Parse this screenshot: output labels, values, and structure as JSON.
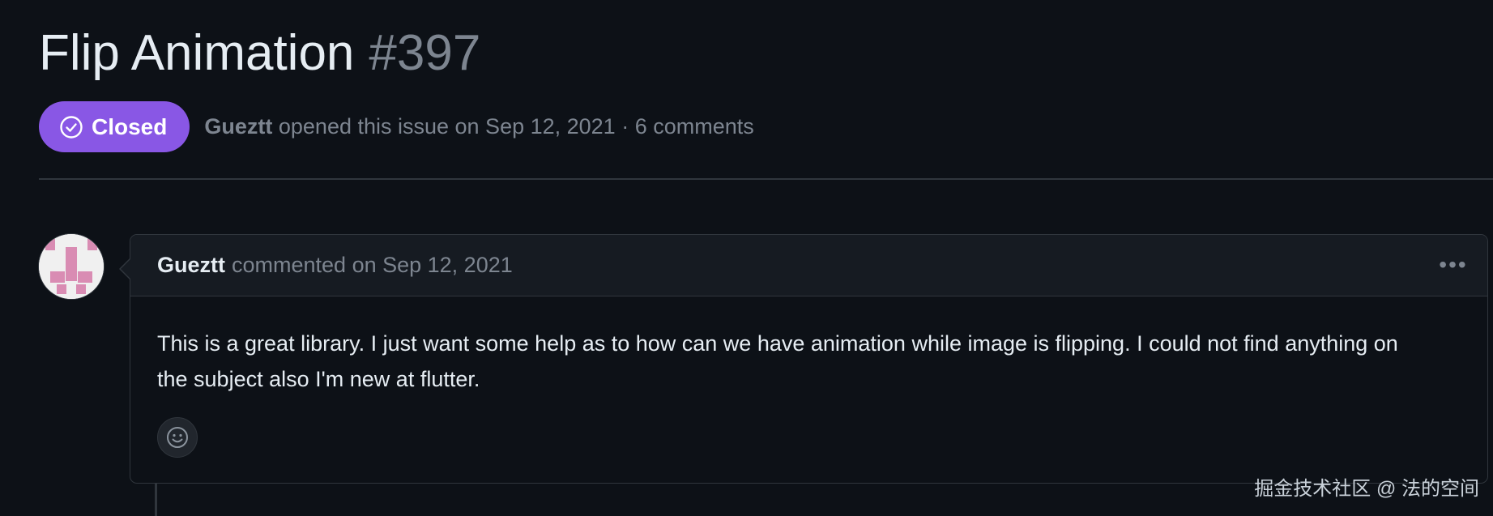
{
  "issue": {
    "title": "Flip Animation",
    "number": "#397",
    "state": "Closed",
    "author": "Gueztt",
    "meta": "opened this issue on Sep 12, 2021 · 6 comments"
  },
  "comment": {
    "author": "Gueztt",
    "date": "commented on Sep 12, 2021",
    "body": "This is a great library. I just want some help as to how can we have animation while image is flipping. I could not find anything on the subject also I'm new at flutter.",
    "menu_label": "•••"
  },
  "watermark": "掘金技术社区 @ 法的空间",
  "colors": {
    "closed_badge": "#8957e5",
    "background": "#0d1117",
    "header_bg": "#161b22",
    "border": "#30363d",
    "muted_text": "#7d8590"
  },
  "icons": {
    "state": "check-circle-icon",
    "reaction": "smiley-icon",
    "menu": "kebab-horizontal-icon"
  }
}
